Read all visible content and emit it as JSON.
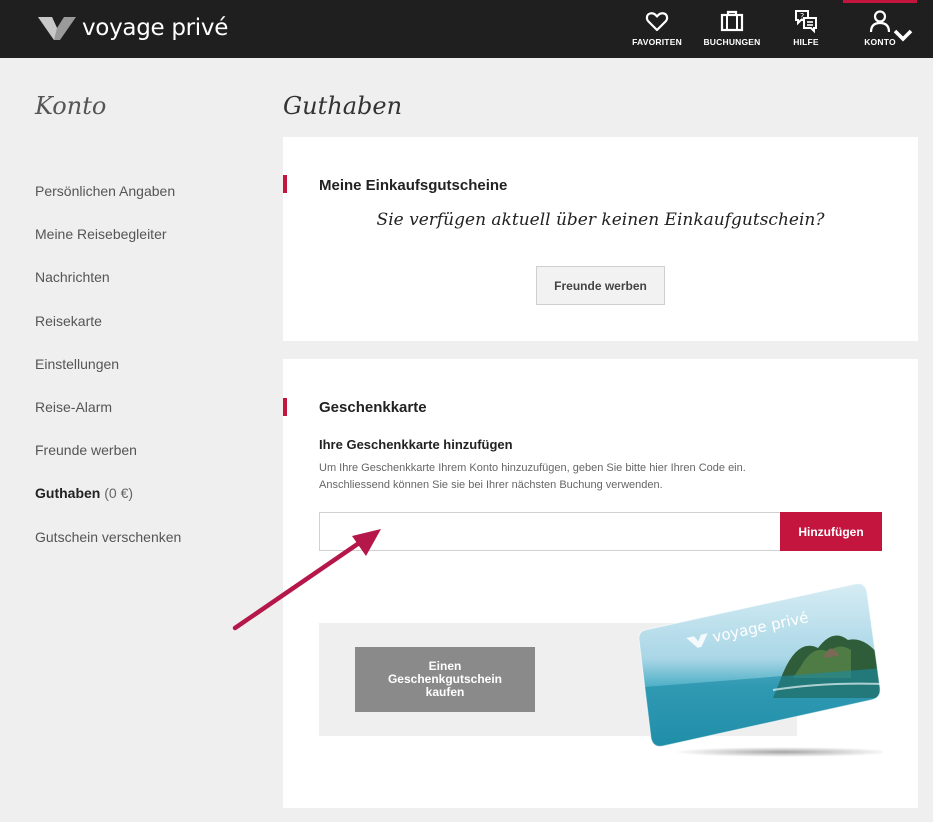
{
  "header": {
    "brand": "voyage privé",
    "nav": [
      {
        "label": "FAVORITEN",
        "icon": "heart-icon"
      },
      {
        "label": "BUCHUNGEN",
        "icon": "suitcase-icon"
      },
      {
        "label": "HILFE",
        "icon": "chat-help-icon"
      },
      {
        "label": "KONTO",
        "icon": "user-icon"
      }
    ],
    "accent_color": "#c4153f"
  },
  "sidebar": {
    "title": "Konto",
    "items": [
      {
        "label": "Persönlichen Angaben"
      },
      {
        "label": "Meine Reisebegleiter"
      },
      {
        "label": "Nachrichten"
      },
      {
        "label": "Reisekarte"
      },
      {
        "label": "Einstellungen"
      },
      {
        "label": "Reise-Alarm"
      },
      {
        "label": "Freunde werben"
      },
      {
        "label": "Guthaben",
        "count": "(0 €)",
        "active": true
      },
      {
        "label": "Gutschein verschenken"
      }
    ]
  },
  "main": {
    "title": "Guthaben",
    "vouchers": {
      "heading": "Meine Einkaufsgutscheine",
      "empty_message": "Sie verfügen aktuell über keinen Einkaufgutschein?",
      "refer_button": "Freunde werben"
    },
    "giftcard": {
      "heading": "Geschenkkarte",
      "subheading": "Ihre Geschenkkarte hinzufügen",
      "hint_line1": "Um Ihre Geschenkkarte Ihrem Konto hinzuzufügen, geben Sie bitte hier Ihren Code ein.",
      "hint_line2": "Anschliessend können Sie sie bei Ihrer nächsten Buchung verwenden.",
      "code_value": "",
      "code_placeholder": "",
      "add_button": "Hinzufügen",
      "buy_button": [
        "Einen",
        "Geschenkgutschein",
        "kaufen"
      ],
      "card_brand": "voyage privé"
    }
  }
}
